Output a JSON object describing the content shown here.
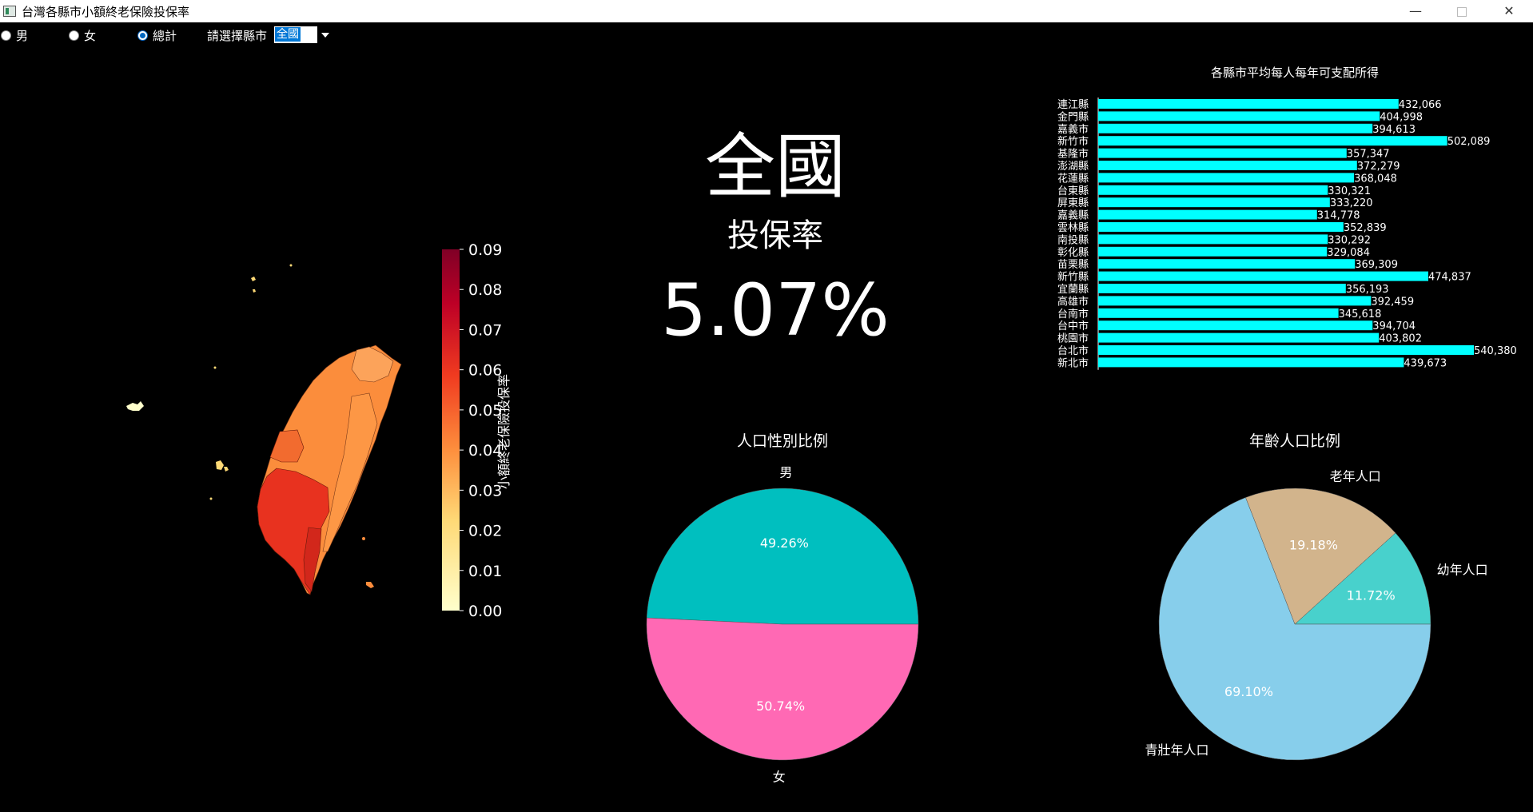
{
  "window": {
    "title": "台灣各縣市小額終老保險投保率"
  },
  "controls": {
    "radios": [
      {
        "label": "男",
        "checked": false
      },
      {
        "label": "女",
        "checked": false
      },
      {
        "label": "總計",
        "checked": true
      }
    ],
    "select_label": "請選擇縣市",
    "select_value": "全國"
  },
  "summary": {
    "region": "全國",
    "rate_label": "投保率",
    "rate_value": "5.07%"
  },
  "map": {
    "colorbar": {
      "label": "小額終老保險投保率",
      "ticks": [
        "0.00",
        "0.01",
        "0.02",
        "0.03",
        "0.04",
        "0.05",
        "0.06",
        "0.07",
        "0.08",
        "0.09"
      ],
      "min": 0.0,
      "max": 0.09
    }
  },
  "chart_data": [
    {
      "type": "bar",
      "orientation": "horizontal",
      "title": "各縣市平均每人每年可支配所得",
      "categories": [
        "連江縣",
        "金門縣",
        "嘉義市",
        "新竹市",
        "基隆市",
        "澎湖縣",
        "花蓮縣",
        "台東縣",
        "屏東縣",
        "嘉義縣",
        "雲林縣",
        "南投縣",
        "彰化縣",
        "苗栗縣",
        "新竹縣",
        "宜蘭縣",
        "高雄市",
        "台南市",
        "台中市",
        "桃園市",
        "台北市",
        "新北市"
      ],
      "values": [
        432066,
        404998,
        394613,
        502089,
        357347,
        372279,
        368048,
        330321,
        333220,
        314778,
        352839,
        330292,
        329084,
        369309,
        474837,
        356193,
        392459,
        345618,
        394704,
        403802,
        540380,
        439673
      ],
      "value_labels": [
        "432,066",
        "404,998",
        "394,613",
        "502,089",
        "357,347",
        "372,279",
        "368,048",
        "330,321",
        "333,220",
        "314,778",
        "352,839",
        "330,292",
        "329,084",
        "369,309",
        "474,837",
        "356,193",
        "392,459",
        "345,618",
        "394,704",
        "403,802",
        "540,380",
        "439,673"
      ],
      "bar_color": "#00ffff",
      "xlim": [
        0,
        540380
      ]
    },
    {
      "type": "pie",
      "title": "人口性別比例",
      "slices": [
        {
          "label": "男",
          "value": 49.26,
          "pct_label": "49.26%",
          "color": "#00bfbf"
        },
        {
          "label": "女",
          "value": 50.74,
          "pct_label": "50.74%",
          "color": "#ff69b4"
        }
      ]
    },
    {
      "type": "pie",
      "title": "年齡人口比例",
      "slices": [
        {
          "label": "幼年人口",
          "value": 11.72,
          "pct_label": "11.72%",
          "color": "#48d1cc"
        },
        {
          "label": "老年人口",
          "value": 19.18,
          "pct_label": "19.18%",
          "color": "#d2b48c"
        },
        {
          "label": "青壯年人口",
          "value": 69.1,
          "pct_label": "69.10%",
          "color": "#87ceeb"
        }
      ]
    }
  ]
}
